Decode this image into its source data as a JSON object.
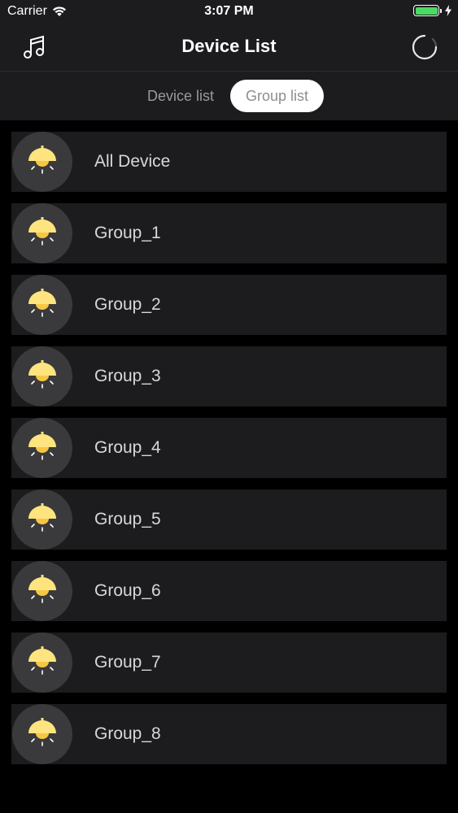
{
  "status": {
    "carrier": "Carrier",
    "time": "3:07 PM",
    "battery_level": 1.0,
    "battery_color": "#4cd964"
  },
  "nav": {
    "title": "Device List",
    "left_icon": "music-note-icon",
    "right_icon": "loading-spinner-icon"
  },
  "segments": {
    "device_list": "Device list",
    "group_list": "Group list",
    "selected": "group_list"
  },
  "groups": [
    {
      "label": "All Device",
      "icon": "lamp-icon"
    },
    {
      "label": "Group_1",
      "icon": "lamp-icon"
    },
    {
      "label": "Group_2",
      "icon": "lamp-icon"
    },
    {
      "label": "Group_3",
      "icon": "lamp-icon"
    },
    {
      "label": "Group_4",
      "icon": "lamp-icon"
    },
    {
      "label": "Group_5",
      "icon": "lamp-icon"
    },
    {
      "label": "Group_6",
      "icon": "lamp-icon"
    },
    {
      "label": "Group_7",
      "icon": "lamp-icon"
    },
    {
      "label": "Group_8",
      "icon": "lamp-icon"
    }
  ],
  "colors": {
    "lamp_yellow": "#fde47f",
    "lamp_bulb": "#f6c744",
    "icon_circle": "#3a3a3c",
    "row_bg": "#1c1c1e"
  }
}
